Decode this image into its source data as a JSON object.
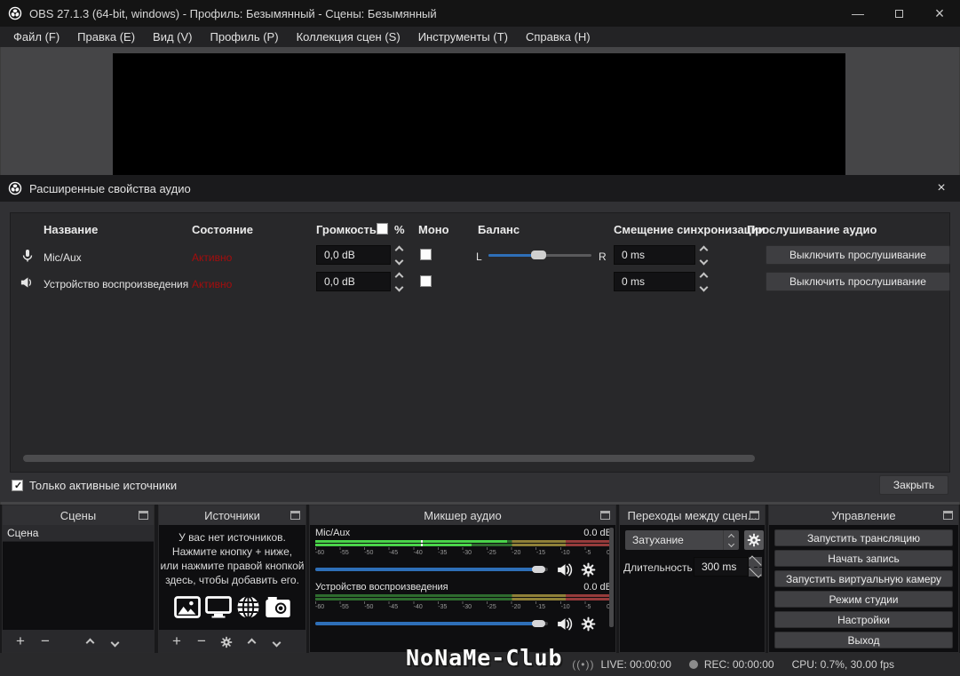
{
  "colors": {
    "accent_blue": "#2e6fb8",
    "status_active_red": "#a50d0d",
    "meter_green_bright": "#4ad44a",
    "meter_green_dim": "#2e6b2e",
    "meter_yellow_dim": "#8f8038",
    "meter_red_dim": "#963b3b"
  },
  "icons": {
    "close_glyph": "×",
    "minimize_glyph": "—",
    "signal_glyph": "((•))",
    "plus_glyph": "+",
    "minus_glyph": "−"
  },
  "titlebar": {
    "title": "OBS 27.1.3 (64-bit, windows) - Профиль: Безымянный - Сцены: Безымянный"
  },
  "menubar": {
    "items": [
      "Файл (F)",
      "Правка (E)",
      "Вид (V)",
      "Профиль (P)",
      "Коллекция сцен (S)",
      "Инструменты (T)",
      "Справка (H)"
    ]
  },
  "dialog": {
    "title": "Расширенные свойства аудио",
    "columns": {
      "name": "Название",
      "status": "Состояние",
      "volume": "Громкость",
      "percent": "%",
      "mono": "Моно",
      "balance": "Баланс",
      "sync_offset": "Смещение синхронизации",
      "monitoring": "Прослушивание аудио"
    },
    "rows": [
      {
        "name": "Mic/Aux",
        "status": "Активно",
        "volume": "0,0 dB",
        "balance_left": "L",
        "balance_right": "R",
        "sync": "0 ms",
        "monitoring": "Выключить прослушивание"
      },
      {
        "name": "Устройство воспроизведения",
        "status": "Активно",
        "volume": "0,0 dB",
        "sync": "0 ms",
        "monitoring": "Выключить прослушивание"
      }
    ],
    "active_only": "Только активные источники",
    "close_button": "Закрыть"
  },
  "scenes": {
    "title": "Сцены",
    "items": [
      "Сцена"
    ]
  },
  "sources": {
    "title": "Источники",
    "empty_lines": [
      "У вас нет источников.",
      "Нажмите кнопку + ниже,",
      "или нажмите правой кнопкой",
      "здесь, чтобы добавить его."
    ]
  },
  "mixer": {
    "title": "Микшер аудио",
    "ticks": [
      "-60",
      "-55",
      "-50",
      "-45",
      "-40",
      "-35",
      "-30",
      "-25",
      "-20",
      "-15",
      "-10",
      "-5",
      "0"
    ],
    "channels": [
      {
        "name": "Mic/Aux",
        "level": "0.0 dB"
      },
      {
        "name": "Устройство воспроизведения",
        "level": "0.0 dB"
      }
    ]
  },
  "transitions": {
    "title": "Переходы между сцен...",
    "selected": "Затухание",
    "duration_label": "Длительность",
    "duration_value": "300 ms"
  },
  "controls": {
    "title": "Управление",
    "buttons": [
      "Запустить трансляцию",
      "Начать запись",
      "Запустить виртуальную камеру",
      "Режим студии",
      "Настройки",
      "Выход"
    ]
  },
  "statusbar": {
    "live": "LIVE: 00:00:00",
    "rec": "REC: 00:00:00",
    "cpu": "CPU: 0.7%, 30.00 fps"
  },
  "watermark": "NoNaMe-Club"
}
